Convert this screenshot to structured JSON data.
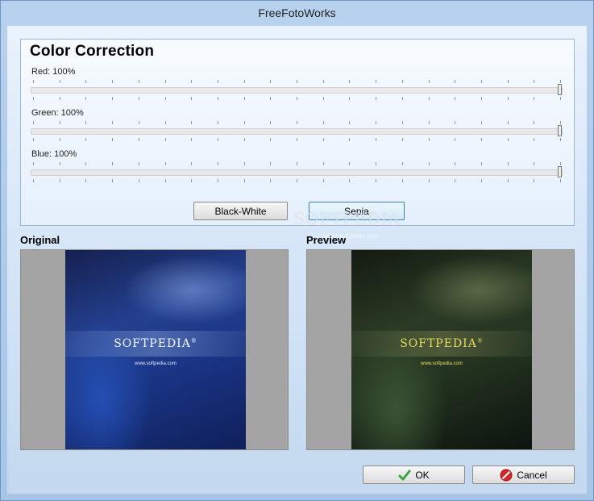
{
  "window": {
    "title": "FreeFotoWorks"
  },
  "color_correction": {
    "title": "Color Correction",
    "sliders": [
      {
        "label": "Red: 100%",
        "value_percent": 100
      },
      {
        "label": "Green: 100%",
        "value_percent": 100
      },
      {
        "label": "Blue: 100%",
        "value_percent": 100
      }
    ],
    "buttons": {
      "black_white": "Black-White",
      "sepia": "Sepia"
    }
  },
  "watermark": {
    "text": "SOFTPEDIA",
    "sub": "www.softpedia.com"
  },
  "images": {
    "original_label": "Original",
    "preview_label": "Preview",
    "logo_text": "SOFTPEDIA",
    "logo_mark": "®",
    "url_text": "www.softpedia.com"
  },
  "footer": {
    "ok": "OK",
    "cancel": "Cancel"
  },
  "icons": {
    "ok": "checkmark-icon",
    "cancel": "cancel-icon"
  },
  "colors": {
    "ok_icon": "#3aa63a",
    "cancel_icon": "#d7262a"
  }
}
